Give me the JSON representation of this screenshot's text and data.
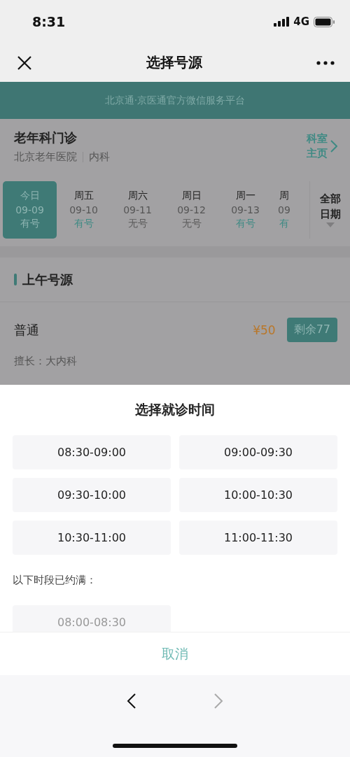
{
  "status_bar": {
    "time": "8:31",
    "network": "4G"
  },
  "nav": {
    "title": "选择号源"
  },
  "banner": {
    "text": "北京通·京医通官方微信服务平台"
  },
  "department": {
    "name": "老年科门诊",
    "hospital": "北京老年医院",
    "category": "内科",
    "link": [
      "科室",
      "主页"
    ]
  },
  "dates": [
    {
      "weekday": "今日",
      "date": "09-09",
      "status": "有号",
      "available": true,
      "selected": true
    },
    {
      "weekday": "周五",
      "date": "09-10",
      "status": "有号",
      "available": true,
      "selected": false
    },
    {
      "weekday": "周六",
      "date": "09-11",
      "status": "无号",
      "available": false,
      "selected": false
    },
    {
      "weekday": "周日",
      "date": "09-12",
      "status": "无号",
      "available": false,
      "selected": false
    },
    {
      "weekday": "周一",
      "date": "09-13",
      "status": "有号",
      "available": true,
      "selected": false
    },
    {
      "weekday": "周",
      "date": "09",
      "status": "有",
      "available": true,
      "selected": false
    }
  ],
  "all_dates": [
    "全部",
    "日期"
  ],
  "section": {
    "title": "上午号源"
  },
  "registration": {
    "type": "普通",
    "price": "¥50",
    "remaining": "剩余77",
    "specialty": "擅长：大内科"
  },
  "sheet": {
    "title": "选择就诊时间",
    "slots": [
      "08:30-09:00",
      "09:00-09:30",
      "09:30-10:00",
      "10:00-10:30",
      "10:30-11:00",
      "11:00-11:30"
    ],
    "full_label": "以下时段已约满：",
    "full_slots": [
      "08:00-08:30"
    ],
    "cancel": "取消"
  }
}
